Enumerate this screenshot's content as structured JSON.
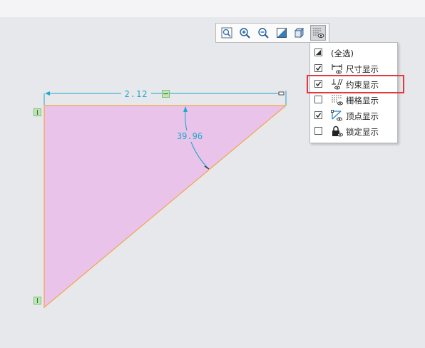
{
  "toolbar": {
    "buttons": [
      {
        "name": "zoom-fit",
        "icon": "zoom-fit-icon"
      },
      {
        "name": "zoom-in",
        "icon": "zoom-in-icon"
      },
      {
        "name": "zoom-out",
        "icon": "zoom-out-icon"
      },
      {
        "name": "display-style",
        "icon": "display-style-icon"
      },
      {
        "name": "view-orientation",
        "icon": "cube-view-icon"
      },
      {
        "name": "sketch-display-filters",
        "icon": "display-filter-icon",
        "active": true
      }
    ]
  },
  "display_filter_menu": {
    "items": [
      {
        "label": "(全选)",
        "checked": "partial",
        "icon": "select-all-icon"
      },
      {
        "label": "尺寸显示",
        "checked": true,
        "icon": "dimension-display-icon"
      },
      {
        "label": "约束显示",
        "checked": true,
        "icon": "constraint-display-icon",
        "highlighted": true
      },
      {
        "label": "栅格显示",
        "checked": false,
        "icon": "grid-display-icon"
      },
      {
        "label": "顶点显示",
        "checked": true,
        "icon": "vertex-display-icon"
      },
      {
        "label": "锁定显示",
        "checked": false,
        "icon": "lock-display-icon"
      }
    ]
  },
  "sketch": {
    "dimension_length": "2.12",
    "dimension_angle": "39.96",
    "fill_color": "#eac3ea",
    "edge_color": "#f3a44a",
    "dimension_color": "#1fa9c9"
  }
}
